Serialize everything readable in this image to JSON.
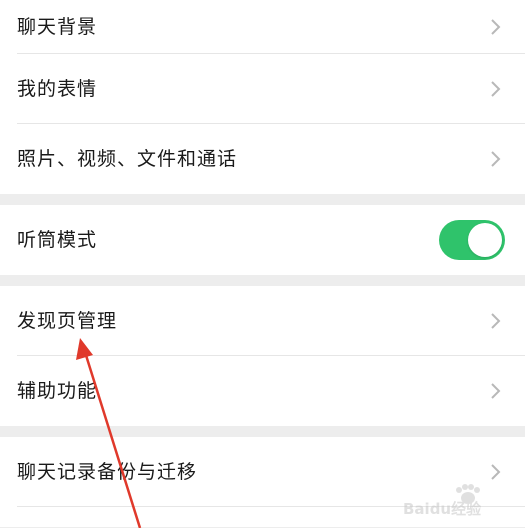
{
  "settings": {
    "group1": [
      {
        "label": "聊天背景"
      },
      {
        "label": "我的表情"
      },
      {
        "label": "照片、视频、文件和通话"
      }
    ],
    "group2": [
      {
        "label": "听筒模式",
        "toggle_on": true
      }
    ],
    "group3": [
      {
        "label": "发现页管理"
      },
      {
        "label": "辅助功能"
      }
    ],
    "group4": [
      {
        "label": "聊天记录备份与迁移"
      }
    ]
  },
  "colors": {
    "toggle_on": "#2fc36b",
    "annotation_arrow": "#e0392b"
  },
  "icons": {
    "chevron": "chevron-right-icon"
  },
  "watermark": {
    "text": "Baidu经验"
  }
}
